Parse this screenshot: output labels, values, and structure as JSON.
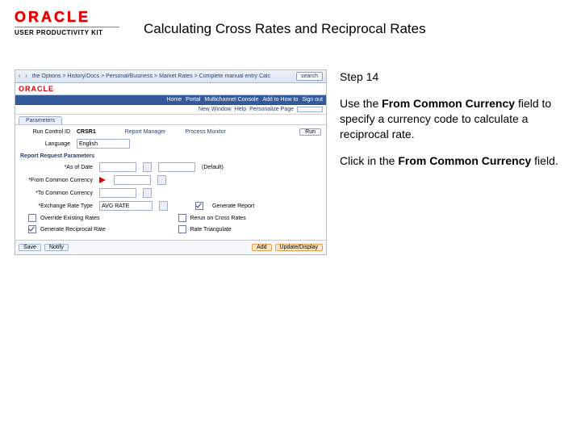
{
  "logo": {
    "name": "ORACLE",
    "subtitle": "USER PRODUCTIVITY KIT"
  },
  "title": "Calculating Cross Rates and Reciprocal Rates",
  "right": {
    "step": "Step 14",
    "para1_pre": "Use the ",
    "para1_bold": "From Common Currency",
    "para1_post": " field to specify a currency code to calculate a reciprocal rate.",
    "para2_pre": "Click in the ",
    "para2_bold": "From Common Currency",
    "para2_post": " field."
  },
  "app": {
    "browser": {
      "back": "‹",
      "fwd": "›",
      "crumbs": "the Options > History/Docs >  Personal/Business >  Market Rates >  Complete manual entry Calc",
      "search": "search"
    },
    "nav_primary": [
      "Home",
      "Portal",
      "Multichannel Console",
      "Add to How to",
      "Sign out"
    ],
    "logo_mini": "ORACLE",
    "user_row": {
      "label1": "New Window",
      "label2": "Help",
      "label3": "Personalize Page"
    },
    "tab": "Parameters",
    "form": {
      "run_control_lbl": "Run Control ID",
      "run_control_val": "CRSR1",
      "report_mgr": "Report Manager",
      "process_mon": "Process Monitor",
      "run_btn": "Run",
      "language_lbl": "Language",
      "language_val": "English",
      "section": "Report Request Parameters",
      "as_of_lbl": "*As of Date",
      "as_of_val": "",
      "rate_type_lbl": "",
      "rate_type_val": "(Default)",
      "from_cur_lbl": "*From Common Currency",
      "to_cur_lbl": "*To Common Currency",
      "exchange_rate_lbl": "*Exchange Rate Type",
      "exchange_rate_val": "AVG RATE",
      "ck1": "Generate Report",
      "ck2": "Override Existing Rates",
      "ck3": "Rerun on Cross Rates",
      "ck4": "Generate Reciprocal Rate",
      "ck5": "Rate Triangulate"
    },
    "footer": {
      "save": "Save",
      "link": "Notify",
      "add": "Add",
      "upd": "Update/Display"
    }
  }
}
